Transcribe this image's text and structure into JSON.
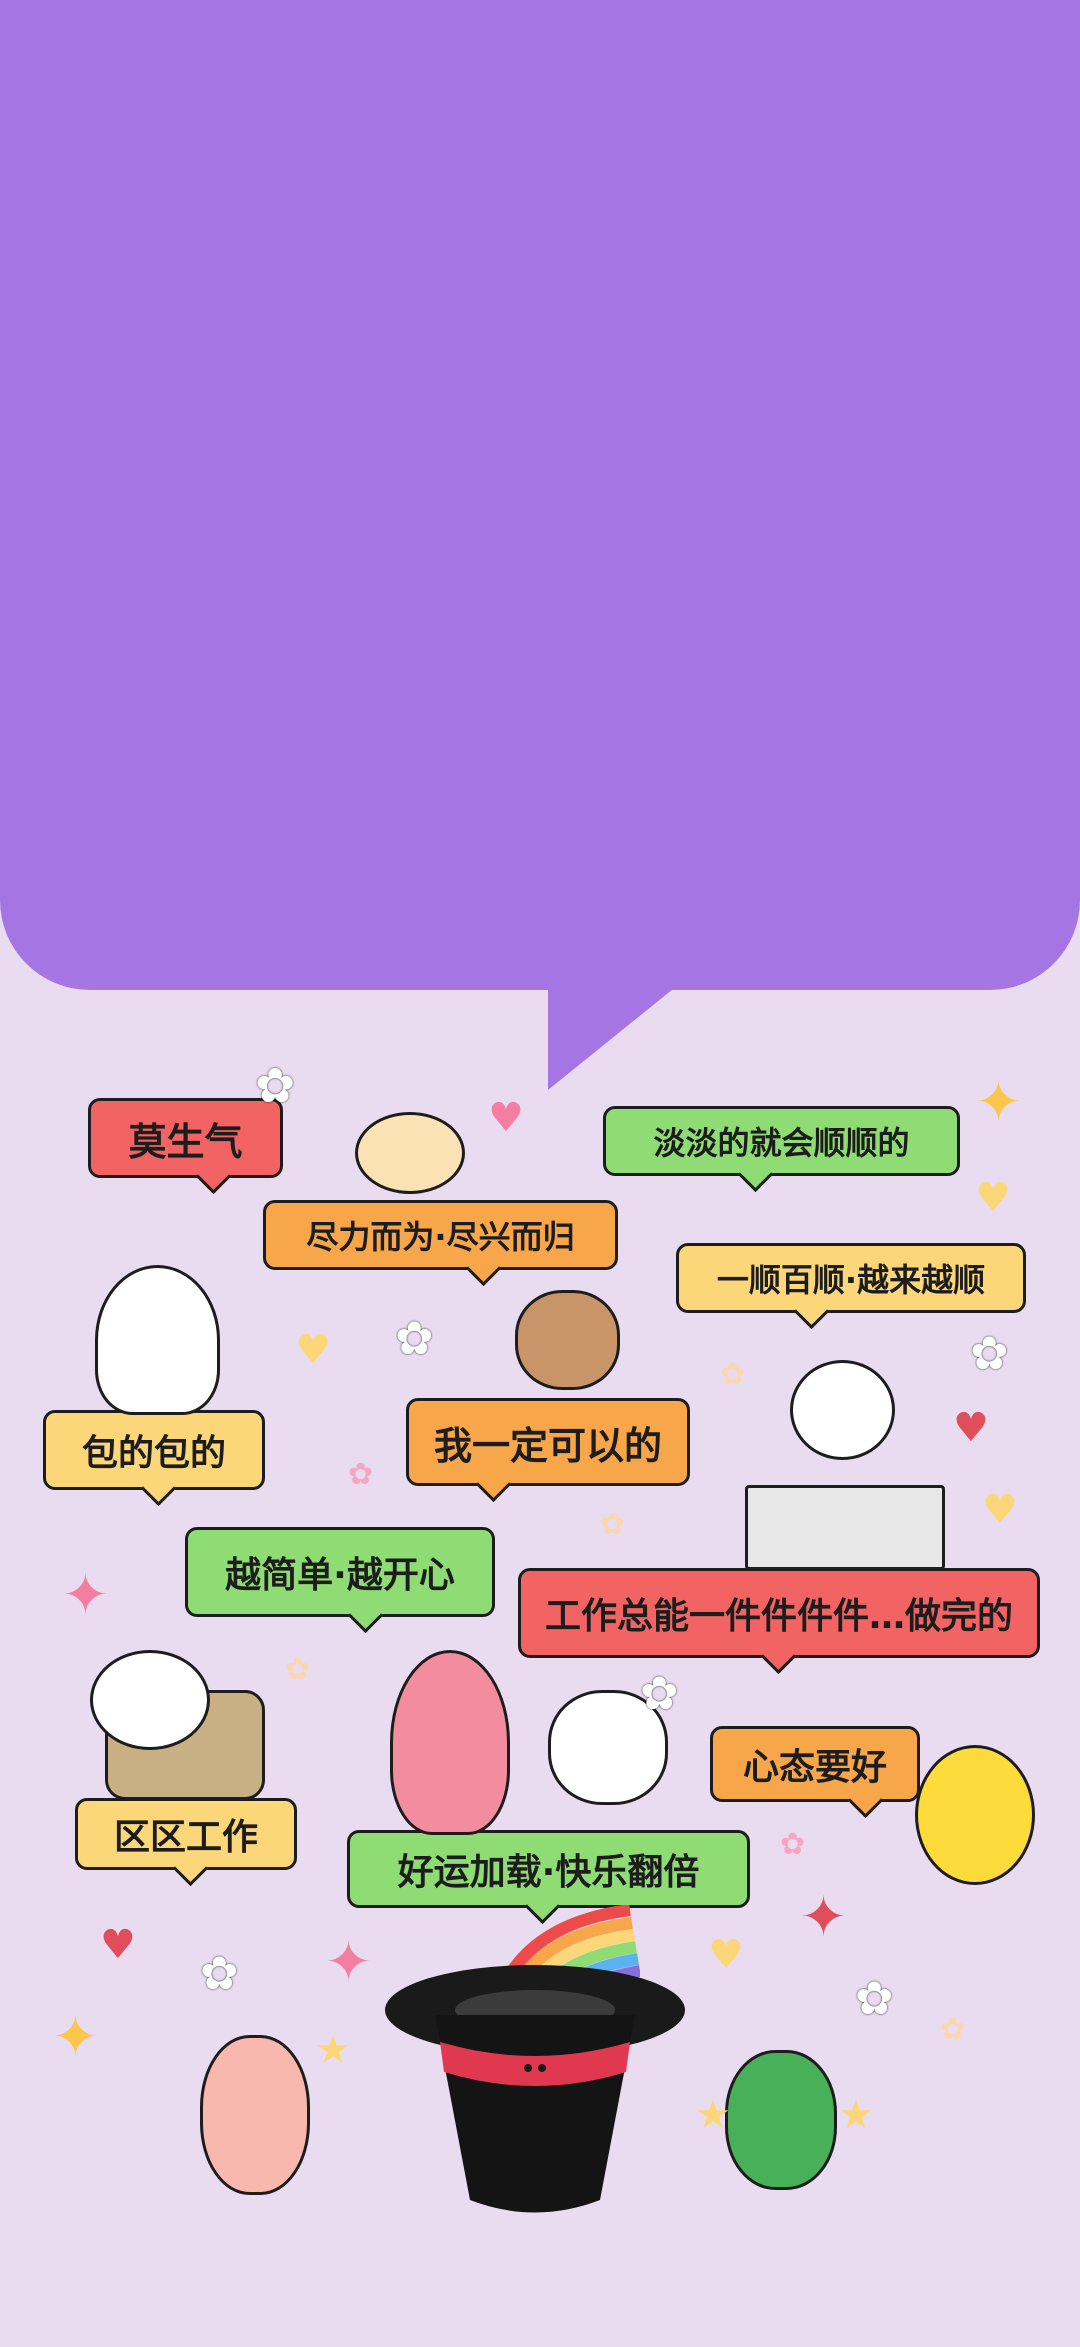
{
  "colors": {
    "background": "#e9dcf0",
    "purple": "#a576e3",
    "red": "#f26363",
    "orange": "#f8a64a",
    "green": "#8fdc74",
    "yellow": "#fcd77a"
  },
  "bubbles": {
    "b1": "莫生气",
    "b2": "尽力而为·尽兴而归",
    "b3": "淡淡的就会顺顺的",
    "b4": "一顺百顺·越来越顺",
    "b5": "包的包的",
    "b6": "我一定可以的",
    "b7": "越简单·越开心",
    "b8": "工作总能一件件件件…做完的",
    "b9": "心态要好",
    "b10": "区区工作",
    "b11": "好运加载·快乐翻倍"
  },
  "icons": [
    "flower-icon",
    "heart-icon",
    "sparkle-icon"
  ]
}
